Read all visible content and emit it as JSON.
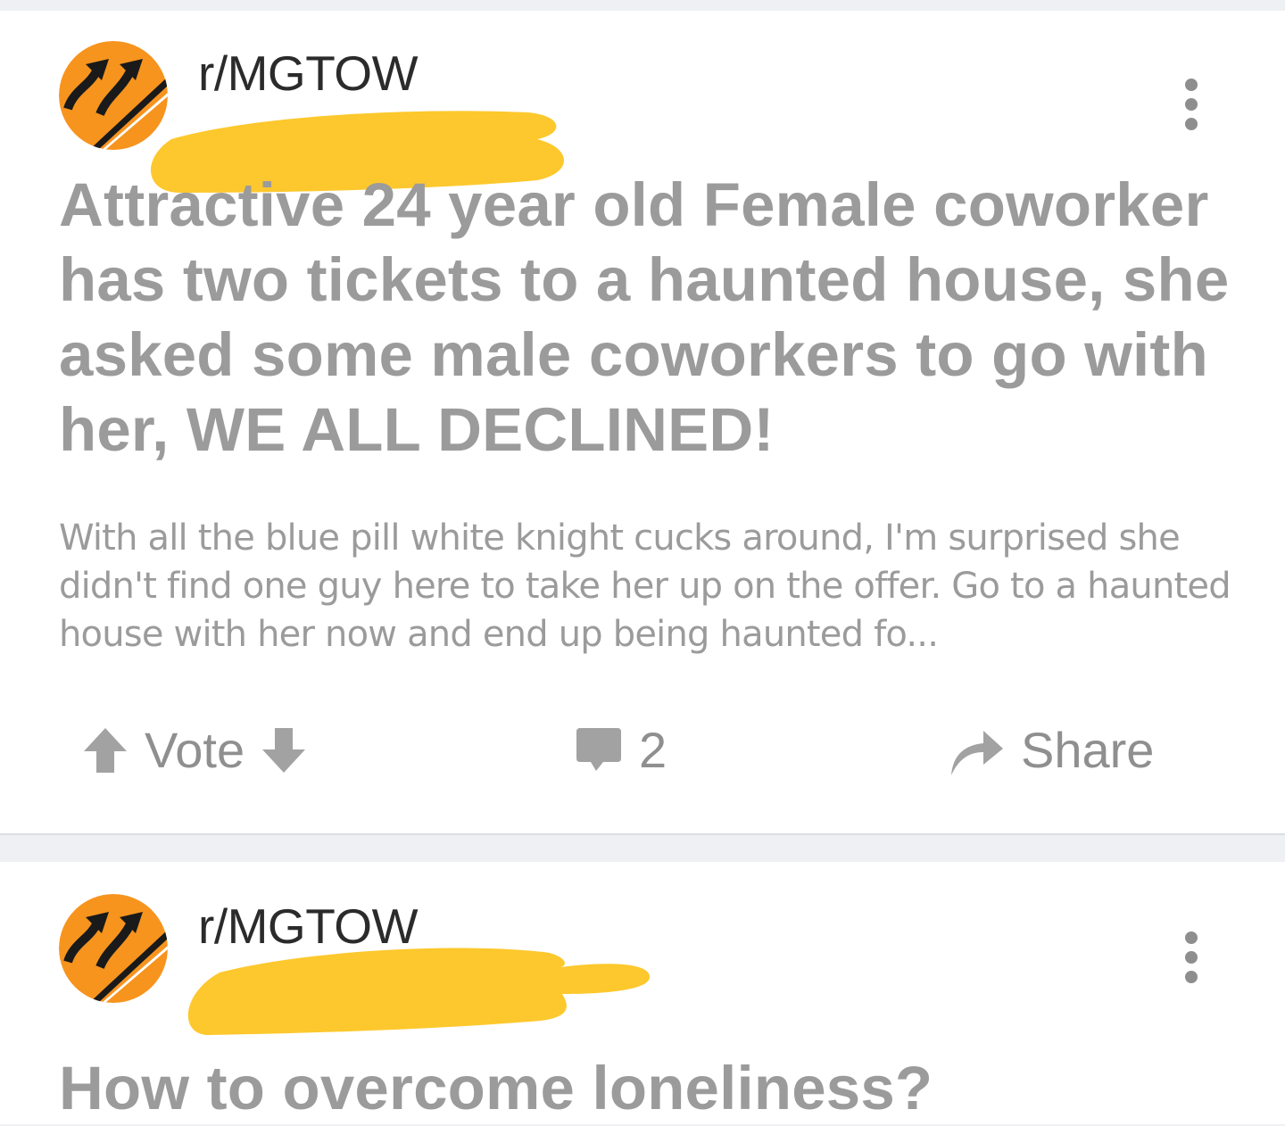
{
  "posts": [
    {
      "subreddit": "r/MGTOW",
      "title": "Attractive 24 year old Female coworker has two tickets to a haunted house, she asked some male coworkers to go with her, WE ALL DECLINED!",
      "body": "With all the blue pill white knight cucks around, I'm surprised she didn't find one guy here to take her up on the offer.  Go to a haunted house with her now and end up being haunted fo...",
      "actions": {
        "vote_label": "Vote",
        "comment_count": "2",
        "share_label": "Share"
      }
    },
    {
      "subreddit": "r/MGTOW",
      "title": "How to overcome loneliness?"
    }
  ],
  "icons": {
    "avatar": "merge-lane-arrows-icon",
    "more": "more-vertical-icon",
    "upvote": "arrow-up-icon",
    "downvote": "arrow-down-icon",
    "comment": "comment-bubble-icon",
    "share": "share-arrow-icon"
  },
  "colors": {
    "avatar_orange": "#f7941e",
    "redaction": "#fdc82d",
    "feed_background": "#eef0f3"
  }
}
